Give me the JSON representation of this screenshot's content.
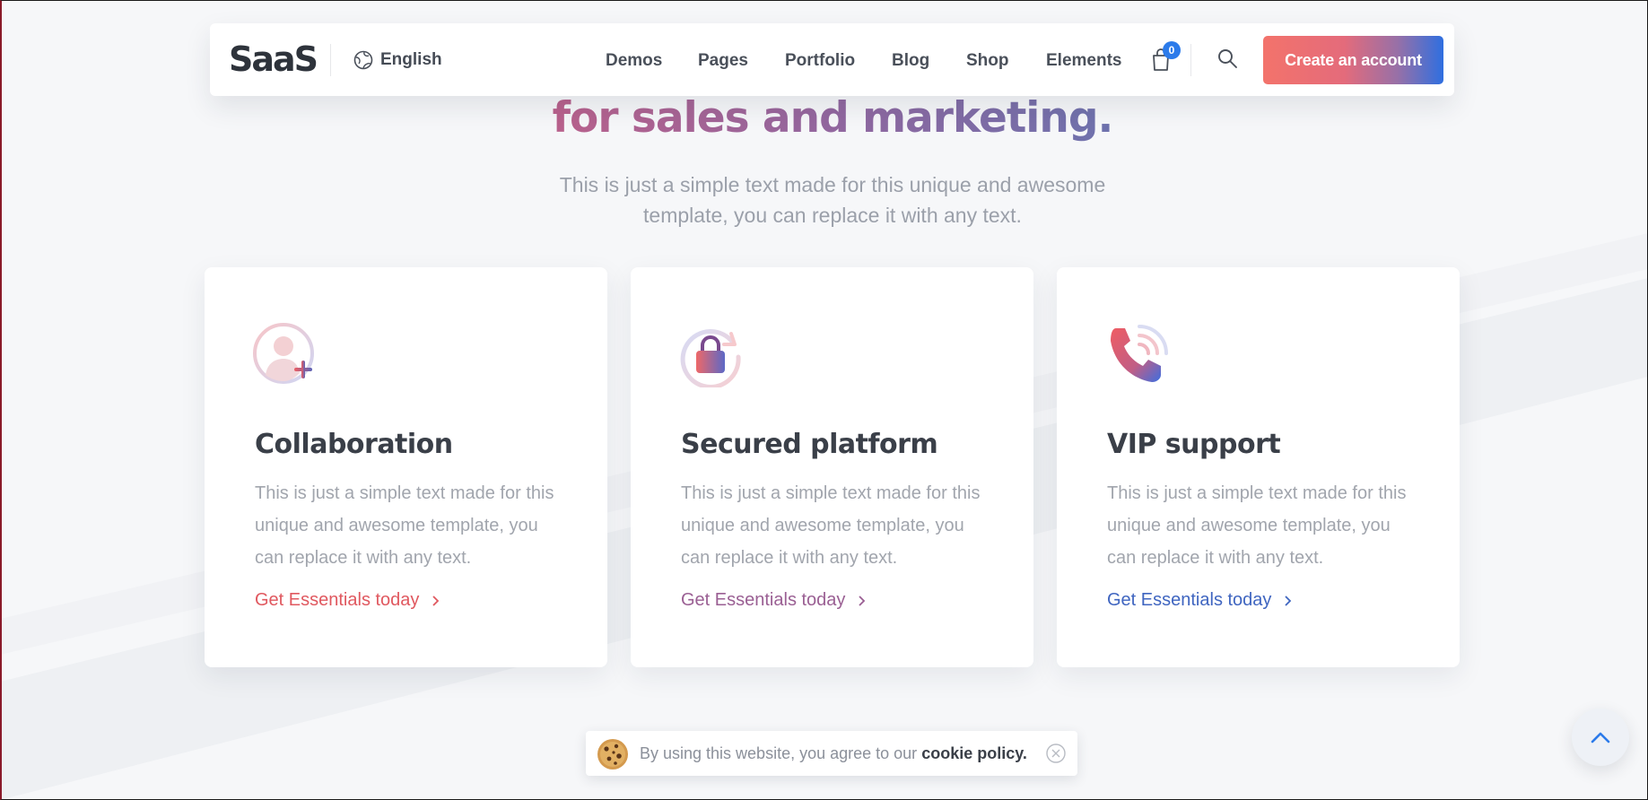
{
  "header": {
    "logo": "SaaS",
    "language": "English",
    "nav": [
      "Demos",
      "Pages",
      "Portfolio",
      "Blog",
      "Shop",
      "Elements"
    ],
    "cart_count": "0",
    "cta": "Create an account"
  },
  "hero": {
    "title": "for sales and marketing.",
    "subtitle": "This is just a simple text made for this unique and awesome template, you can replace it with any text."
  },
  "cards": [
    {
      "icon": "add-user-icon",
      "title": "Collaboration",
      "text": "This is just a simple text made for this unique and awesome template, you can replace it with any text.",
      "link": "Get Essentials today",
      "link_color": "#e0585f"
    },
    {
      "icon": "lock-refresh-icon",
      "title": "Secured platform",
      "text": "This is just a simple text made for this unique and awesome template, you can replace it with any text.",
      "link": "Get Essentials today",
      "link_color": "#9a5f93"
    },
    {
      "icon": "phone-call-icon",
      "title": "VIP support",
      "text": "This is just a simple text made for this unique and awesome template, you can replace it with any text.",
      "link": "Get Essentials today",
      "link_color": "#3f65c0"
    }
  ],
  "cookie": {
    "text": "By using this website, you agree to our",
    "link": "cookie policy."
  },
  "colors": {
    "cta_gradient_start": "#f3736b",
    "cta_gradient_end": "#2f6fe0",
    "badge": "#2c7bea"
  }
}
